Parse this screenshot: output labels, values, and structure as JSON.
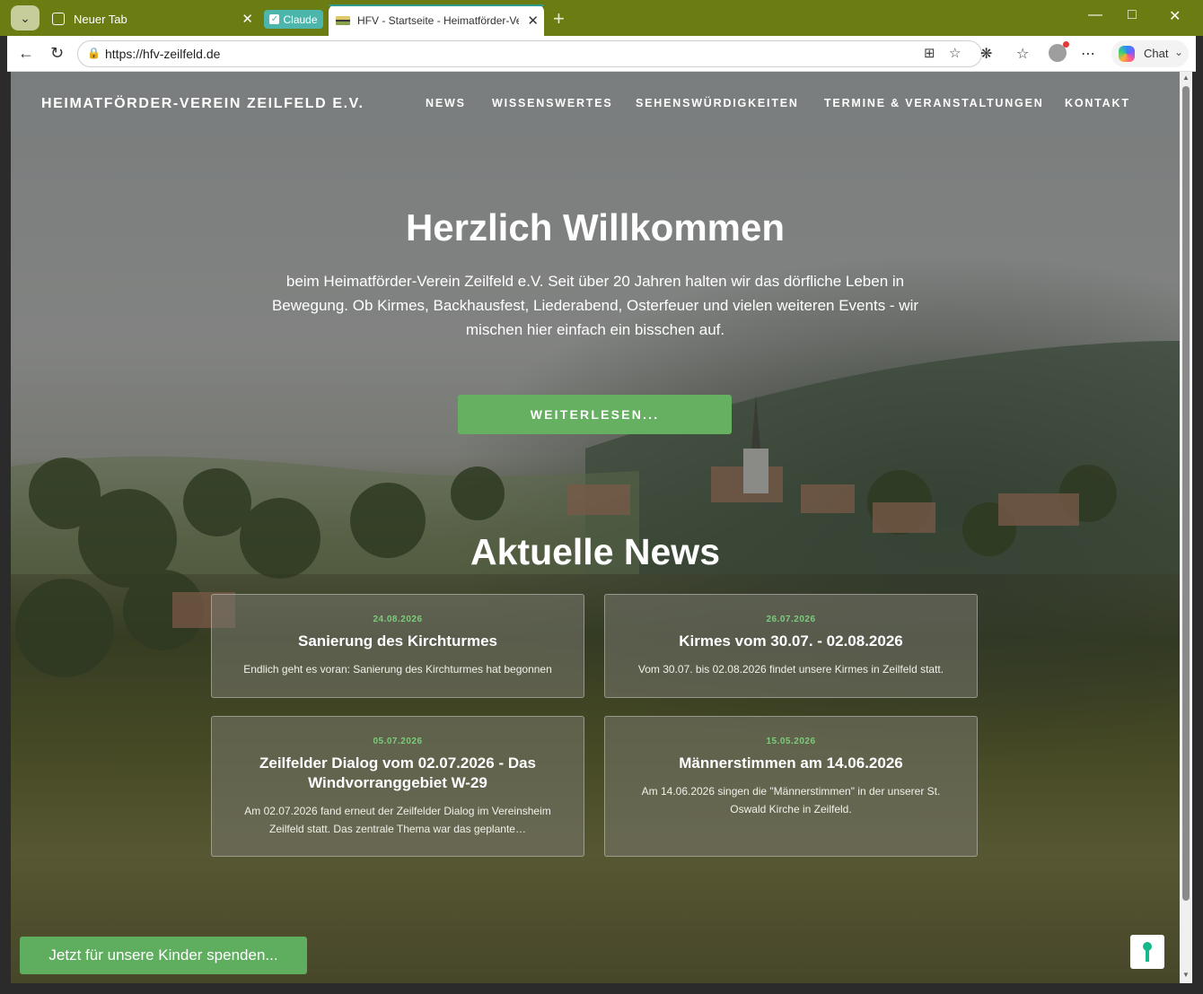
{
  "browser": {
    "tabs": [
      {
        "label": "Neuer Tab"
      },
      {
        "label": "HFV - Startseite - Heimatförder-Ve"
      }
    ],
    "claude_chip": "Claude",
    "url": "https://hfv-zeilfeld.de",
    "chat_label": "Chat"
  },
  "site": {
    "title": "HEIMATFÖRDER-VEREIN ZEILFELD E.V.",
    "nav": [
      "NEWS",
      "WISSENSWERTES",
      "SEHENSWÜRDIGKEITEN",
      "TERMINE & VERANSTALTUNGEN",
      "KONTAKT"
    ]
  },
  "hero": {
    "title": "Herzlich Willkommen",
    "text": "beim Heimatförder-Verein Zeilfeld e.V. Seit über 20 Jahren halten wir das dörfliche Leben in Bewegung. Ob Kirmes, Backhausfest, Liederabend, Osterfeuer und vielen weiteren Events - wir mischen hier einfach ein bisschen auf.",
    "button": "WEITERLESEN..."
  },
  "news": {
    "title": "Aktuelle News",
    "items": [
      {
        "date": "24.08.2026",
        "title": "Sanierung des Kirchturmes",
        "text": "Endlich geht es voran: Sanierung des Kirchturmes hat begonnen"
      },
      {
        "date": "26.07.2026",
        "title": "Kirmes vom 30.07. - 02.08.2026",
        "text": "Vom 30.07. bis 02.08.2026 findet unsere Kirmes in Zeilfeld statt."
      },
      {
        "date": "05.07.2026",
        "title": "Zeilfelder Dialog vom 02.07.2026 - Das Windvorranggebiet W-29",
        "text": "Am 02.07.2026 fand erneut der Zeilfelder Dialog im Vereinsheim Zeilfeld statt. Das zentrale Thema war das geplante…"
      },
      {
        "date": "15.05.2026",
        "title": "Männerstimmen am 14.06.2026",
        "text": "Am 14.06.2026 singen die \"Männerstimmen\" in der unserer St. Oswald Kirche in Zeilfeld."
      }
    ]
  },
  "donate_button": "Jetzt für unsere Kinder spenden..."
}
